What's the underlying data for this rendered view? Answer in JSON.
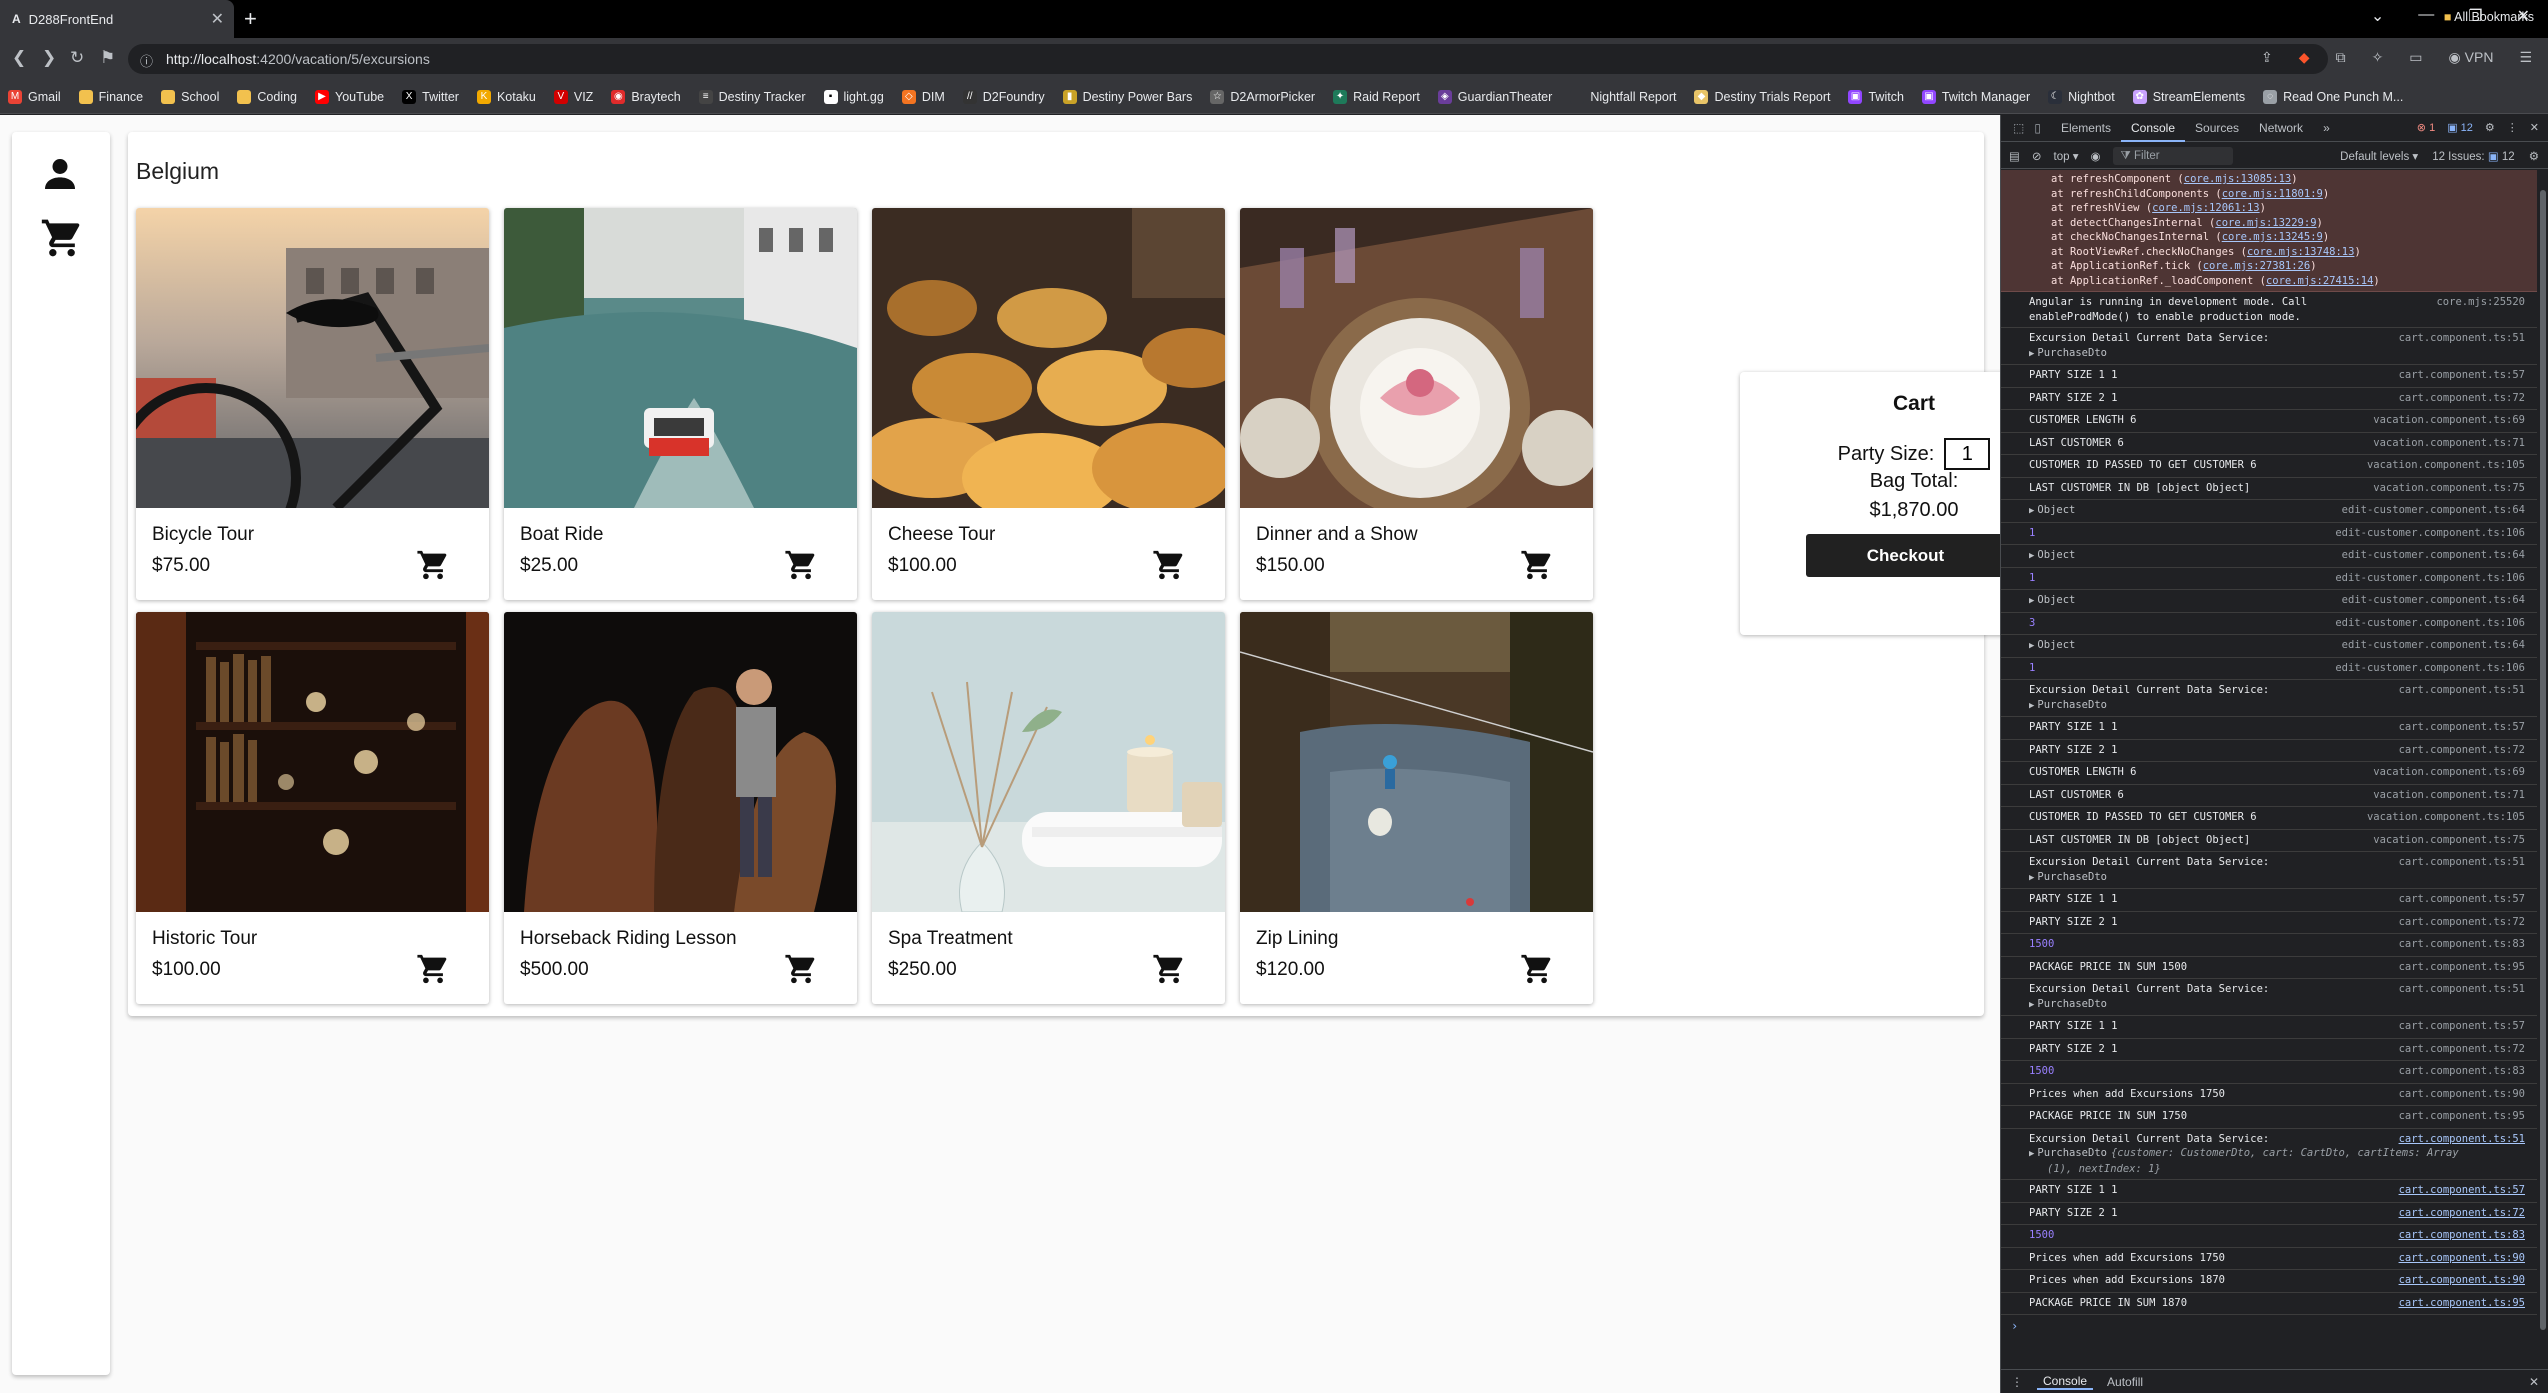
{
  "browser": {
    "tab_title": "D288FrontEnd",
    "tab_favicon": "A",
    "url_host": "http://localhost",
    "url_rest": ":4200/vacation/5/excursions",
    "vpn_label": "VPN",
    "all_bookmarks": "All Bookmarks",
    "bookmarks": [
      {
        "label": "Gmail",
        "icon": "gmail-icon",
        "color": "#ea4335",
        "glyph": "M"
      },
      {
        "label": "Finance",
        "icon": "folder-icon",
        "color": "#f2c14e",
        "glyph": ""
      },
      {
        "label": "School",
        "icon": "folder-icon",
        "color": "#f2c14e",
        "glyph": ""
      },
      {
        "label": "Coding",
        "icon": "folder-icon",
        "color": "#f2c14e",
        "glyph": ""
      },
      {
        "label": "YouTube",
        "icon": "youtube-icon",
        "color": "#ff0000",
        "glyph": "▶"
      },
      {
        "label": "Twitter",
        "icon": "x-icon",
        "color": "#000000",
        "glyph": "X"
      },
      {
        "label": "Kotaku",
        "icon": "kotaku-icon",
        "color": "#f2a900",
        "glyph": "K"
      },
      {
        "label": "VIZ",
        "icon": "viz-icon",
        "color": "#d10000",
        "glyph": "V"
      },
      {
        "label": "Braytech",
        "icon": "braytech-icon",
        "color": "#e02b2b",
        "glyph": "◉"
      },
      {
        "label": "Destiny Tracker",
        "icon": "destiny-tracker-icon",
        "color": "#444444",
        "glyph": "≡"
      },
      {
        "label": "light.gg",
        "icon": "lightgg-icon",
        "color": "#ffffff",
        "glyph": "▪"
      },
      {
        "label": "DIM",
        "icon": "dim-icon",
        "color": "#f37421",
        "glyph": "◇"
      },
      {
        "label": "D2Foundry",
        "icon": "d2foundry-icon",
        "color": "#333333",
        "glyph": "//"
      },
      {
        "label": "Destiny Power Bars",
        "icon": "power-bars-icon",
        "color": "#c9a227",
        "glyph": "▮"
      },
      {
        "label": "D2ArmorPicker",
        "icon": "armorpicker-icon",
        "color": "#666666",
        "glyph": "☆"
      },
      {
        "label": "Raid Report",
        "icon": "raid-report-icon",
        "color": "#1e7a5a",
        "glyph": "✦"
      },
      {
        "label": "GuardianTheater",
        "icon": "guardiantheater-icon",
        "color": "#6a3d9a",
        "glyph": "◈"
      },
      {
        "label": "Nightfall Report",
        "icon": "nightfall-icon",
        "color": "#35363a",
        "glyph": ""
      },
      {
        "label": "Destiny Trials Report",
        "icon": "trials-report-icon",
        "color": "#e8c468",
        "glyph": "◆"
      },
      {
        "label": "Twitch",
        "icon": "twitch-icon",
        "color": "#9146ff",
        "glyph": "▣"
      },
      {
        "label": "Twitch Manager",
        "icon": "twitch-icon",
        "color": "#9146ff",
        "glyph": "▣"
      },
      {
        "label": "Nightbot",
        "icon": "nightbot-icon",
        "color": "#2a2f3a",
        "glyph": "☾"
      },
      {
        "label": "StreamElements",
        "icon": "streamelements-icon",
        "color": "#c8a2ff",
        "glyph": "✿"
      },
      {
        "label": "Read One Punch M...",
        "icon": "globe-icon",
        "color": "#9aa0a6",
        "glyph": "◌"
      }
    ]
  },
  "page": {
    "title": "Belgium",
    "excursions": [
      {
        "name": "Bicycle Tour",
        "price": "$75.00",
        "image": "bicycle-photo"
      },
      {
        "name": "Boat Ride",
        "price": "$25.00",
        "image": "boat-photo"
      },
      {
        "name": "Cheese Tour",
        "price": "$100.00",
        "image": "cheese-photo"
      },
      {
        "name": "Dinner and a Show",
        "price": "$150.00",
        "image": "dinner-photo"
      },
      {
        "name": "Historic Tour",
        "price": "$100.00",
        "image": "library-photo"
      },
      {
        "name": "Horseback Riding Lesson",
        "price": "$500.00",
        "image": "horses-photo"
      },
      {
        "name": "Spa Treatment",
        "price": "$250.00",
        "image": "spa-photo"
      },
      {
        "name": "Zip Lining",
        "price": "$120.00",
        "image": "zipline-photo"
      }
    ],
    "cart": {
      "title": "Cart",
      "party_size_label": "Party Size:",
      "party_size_value": "1",
      "bag_total_label": "Bag Total:",
      "bag_total_value": "$1,870.00",
      "checkout_label": "Checkout"
    }
  },
  "devtools": {
    "tabs": [
      "Elements",
      "Console",
      "Sources",
      "Network"
    ],
    "active_tab": "Console",
    "error_count": "1",
    "message_count": "12",
    "context": "top",
    "filter_placeholder": "Filter",
    "levels": "Default levels",
    "issues": "12 Issues:",
    "issues_count": "12",
    "drawer_tabs": [
      "Console",
      "Autofill"
    ],
    "stack": [
      {
        "text": "at refreshComponent (",
        "link": "core.mjs:13085:13",
        "end": ")"
      },
      {
        "text": "at refreshChildComponents (",
        "link": "core.mjs:11801:9",
        "end": ")"
      },
      {
        "text": "at refreshView (",
        "link": "core.mjs:12061:13",
        "end": ")"
      },
      {
        "text": "at detectChangesInternal (",
        "link": "core.mjs:13229:9",
        "end": ")"
      },
      {
        "text": "at checkNoChangesInternal (",
        "link": "core.mjs:13245:9",
        "end": ")"
      },
      {
        "text": "at RootViewRef.checkNoChanges (",
        "link": "core.mjs:13748:13",
        "end": ")"
      },
      {
        "text": "at ApplicationRef.tick (",
        "link": "core.mjs:27381:26",
        "end": ")"
      },
      {
        "text": "at ApplicationRef._loadComponent (",
        "link": "core.mjs:27415:14",
        "end": ")"
      }
    ],
    "logs": [
      {
        "msg": "Angular is running in development mode. Call",
        "msg2": "enableProdMode() to enable production mode.",
        "src": "core.mjs:25520"
      },
      {
        "msg": "Excursion Detail Current Data Service:",
        "obj": "PurchaseDto",
        "src": "cart.component.ts:51"
      },
      {
        "msg": "PARTY SIZE 1 1",
        "src": "cart.component.ts:57"
      },
      {
        "msg": "PARTY SIZE 2 1",
        "src": "cart.component.ts:72"
      },
      {
        "msg": "CUSTOMER LENGTH 6",
        "src": "vacation.component.ts:69"
      },
      {
        "msg": "LAST CUSTOMER 6",
        "src": "vacation.component.ts:71"
      },
      {
        "msg": "CUSTOMER ID PASSED TO GET CUSTOMER 6",
        "src": "vacation.component.ts:105"
      },
      {
        "msg": "LAST CUSTOMER IN DB [object Object]",
        "src": "vacation.component.ts:75"
      },
      {
        "obj": "Object",
        "src": "edit-customer.component.ts:64"
      },
      {
        "num": "1",
        "src": "edit-customer.component.ts:106"
      },
      {
        "obj": "Object",
        "src": "edit-customer.component.ts:64"
      },
      {
        "num": "1",
        "src": "edit-customer.component.ts:106"
      },
      {
        "obj": "Object",
        "src": "edit-customer.component.ts:64"
      },
      {
        "num": "3",
        "src": "edit-customer.component.ts:106"
      },
      {
        "obj": "Object",
        "src": "edit-customer.component.ts:64"
      },
      {
        "num": "1",
        "src": "edit-customer.component.ts:106"
      },
      {
        "msg": "Excursion Detail Current Data Service:",
        "obj": "PurchaseDto",
        "src": "cart.component.ts:51"
      },
      {
        "msg": "PARTY SIZE 1 1",
        "src": "cart.component.ts:57"
      },
      {
        "msg": "PARTY SIZE 2 1",
        "src": "cart.component.ts:72"
      },
      {
        "msg": "CUSTOMER LENGTH 6",
        "src": "vacation.component.ts:69"
      },
      {
        "msg": "LAST CUSTOMER 6",
        "src": "vacation.component.ts:71"
      },
      {
        "msg": "CUSTOMER ID PASSED TO GET CUSTOMER 6",
        "src": "vacation.component.ts:105"
      },
      {
        "msg": "LAST CUSTOMER IN DB [object Object]",
        "src": "vacation.component.ts:75"
      },
      {
        "msg": "Excursion Detail Current Data Service:",
        "obj": "PurchaseDto",
        "src": "cart.component.ts:51"
      },
      {
        "msg": "PARTY SIZE 1 1",
        "src": "cart.component.ts:57"
      },
      {
        "msg": "PARTY SIZE 2 1",
        "src": "cart.component.ts:72"
      },
      {
        "num": "1500",
        "src": "cart.component.ts:83"
      },
      {
        "msg": "PACKAGE PRICE IN SUM 1500",
        "src": "cart.component.ts:95"
      },
      {
        "msg": "Excursion Detail Current Data Service:",
        "obj": "PurchaseDto",
        "src": "cart.component.ts:51"
      },
      {
        "msg": "PARTY SIZE 1 1",
        "src": "cart.component.ts:57"
      },
      {
        "msg": "PARTY SIZE 2 1",
        "src": "cart.component.ts:72"
      },
      {
        "num": "1500",
        "src": "cart.component.ts:83"
      },
      {
        "msg": "Prices when add Excursions 1750",
        "src": "cart.component.ts:90"
      },
      {
        "msg": "PACKAGE PRICE IN SUM 1750",
        "src": "cart.component.ts:95"
      },
      {
        "msg": "Excursion Detail Current Data Service:",
        "obj": "PurchaseDto",
        "objdetail": "{customer: CustomerDto, cart: CartDto, cartItems: Array",
        "objdetail2": "(1), nextIndex: 1}",
        "src": "cart.component.ts:51",
        "u": true
      },
      {
        "msg": "PARTY SIZE 1 1",
        "src": "cart.component.ts:57",
        "u": true
      },
      {
        "msg": "PARTY SIZE 2 1",
        "src": "cart.component.ts:72",
        "u": true
      },
      {
        "num": "1500",
        "src": "cart.component.ts:83",
        "u": true
      },
      {
        "msg": "Prices when add Excursions 1750",
        "src": "cart.component.ts:90",
        "u": true
      },
      {
        "msg": "Prices when add Excursions 1870",
        "src": "cart.component.ts:90",
        "u": true
      },
      {
        "msg": "PACKAGE PRICE IN SUM 1870",
        "src": "cart.component.ts:95",
        "u": true
      }
    ]
  }
}
